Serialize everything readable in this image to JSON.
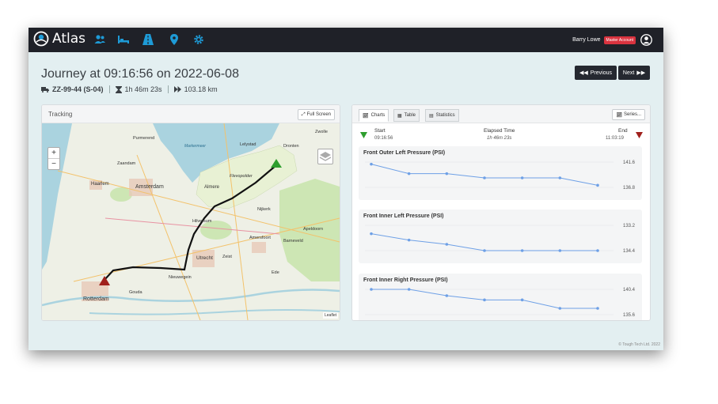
{
  "app": {
    "name": "Atlas"
  },
  "nav": {
    "icons": [
      "users-icon",
      "bed-icon",
      "road-icon",
      "map-marker-icon",
      "gear-icon"
    ]
  },
  "user": {
    "name": "Barry Lowe",
    "badge": "Master Account"
  },
  "journey": {
    "title": "Journey at 09:16:56 on 2022-06-08",
    "vehicle": "ZZ-99-44 (S-04)",
    "duration": "1h 46m 23s",
    "distance": "103.18 km"
  },
  "buttons": {
    "previous": "Previous",
    "next": "Next"
  },
  "tracking": {
    "title": "Tracking",
    "fullscreen": "Full Screen",
    "attribution": "Leaflet"
  },
  "map_labels": {
    "amsterdam": "Amsterdam",
    "haarlem": "Haarlem",
    "almere": "Almere",
    "utrecht": "Utrecht",
    "rotterdam": "Rotterdam",
    "nieuwegein": "Nieuwegein",
    "dronten": "Dronten",
    "lelystad": "Lelystad",
    "apeldoorn": "Apeldoorn",
    "amersfoort": "Amersfoort",
    "nijkerk": "Nijkerk",
    "hilversum": "Hilversum",
    "zeist": "Zeist",
    "barneveld": "Barneveld",
    "ede": "Ede",
    "gouda": "Gouda",
    "zwolle": "Zwolle",
    "purmerend": "Purmerend",
    "zaandam": "Zaandam",
    "flevopolder": "Flevopolder",
    "markermeer": "Markermeer"
  },
  "tabs": {
    "charts": "Charts",
    "table": "Table",
    "statistics": "Statistics",
    "series": "Series..."
  },
  "summary": {
    "start_label": "Start",
    "start_time": "09:16:56",
    "elapsed_label": "Elapsed Time",
    "elapsed_value": "1h 46m 23s",
    "end_label": "End",
    "end_time": "11:03:19"
  },
  "colors": {
    "start": "#2e9e2e",
    "end": "#a0201c",
    "line": "#6ea0e6",
    "brand": "#1e9bd7"
  },
  "chart_data": [
    {
      "type": "line",
      "title": "Front Outer Left Pressure (PSI)",
      "ylim": [
        136.8,
        141.6
      ],
      "y_ticks": [
        "141.6",
        "136.8"
      ],
      "values": [
        141.2,
        139.4,
        139.4,
        138.6,
        138.6,
        138.6,
        137.2
      ]
    },
    {
      "type": "line",
      "title": "Front Inner Left Pressure (PSI)",
      "ylim": [
        134.4,
        133.2
      ],
      "y_ticks": [
        "133.2",
        "134.4"
      ],
      "values": [
        133.6,
        133.9,
        134.1,
        134.4,
        134.4,
        134.4,
        134.4
      ]
    },
    {
      "type": "line",
      "title": "Front Inner Right Pressure (PSI)",
      "ylim": [
        135.6,
        140.4
      ],
      "y_ticks": [
        "140.4",
        "135.6"
      ],
      "values": [
        140.4,
        140.4,
        139.2,
        138.4,
        138.4,
        136.8,
        136.8
      ]
    }
  ],
  "footer": "© Tough Tech Ltd. 2022"
}
